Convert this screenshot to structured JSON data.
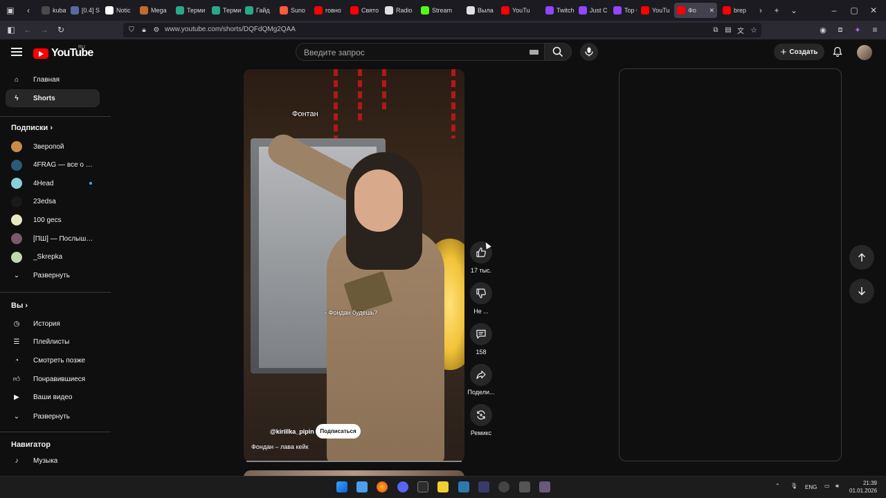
{
  "browser": {
    "tabs": [
      {
        "title": "kubat",
        "color": "#4a4a4a"
      },
      {
        "title": "[0.4] S",
        "color": "#5a6aa0"
      },
      {
        "title": "Notic",
        "color": "#ffffff"
      },
      {
        "title": "Mega",
        "color": "#c46a2a"
      },
      {
        "title": "Терми",
        "color": "#2aa88a"
      },
      {
        "title": "Терми",
        "color": "#2aa88a"
      },
      {
        "title": "Гайд",
        "color": "#2aa88a"
      },
      {
        "title": "Suno",
        "color": "#ff5a3a"
      },
      {
        "title": "говно",
        "color": "#ff0000"
      },
      {
        "title": "Свято",
        "color": "#ff0000"
      },
      {
        "title": "Radio",
        "color": "#e0e0e0"
      },
      {
        "title": "Stream",
        "color": "#53fc18"
      },
      {
        "title": "Выла",
        "color": "#e0e0e0"
      },
      {
        "title": "YouTu",
        "color": "#ff0000"
      },
      {
        "title": "Twitch",
        "color": "#9146ff"
      },
      {
        "title": "Just C",
        "color": "#9146ff"
      },
      {
        "title": "Top C",
        "color": "#9146ff"
      },
      {
        "title": "YouTu",
        "color": "#ff0000"
      },
      {
        "title": "Фо",
        "color": "#ff0000",
        "active": true
      },
      {
        "title": "brep",
        "color": "#ff0000"
      }
    ],
    "url": "www.youtube.com/shorts/DQFdQMg2QAA"
  },
  "header": {
    "logo_text": "YouTube",
    "logo_region": "RU",
    "search_placeholder": "Введите запрос",
    "create_label": "Создать"
  },
  "sidebar": {
    "top": [
      {
        "label": "Главная",
        "icon": "home-icon"
      },
      {
        "label": "Shorts",
        "icon": "shorts-icon",
        "active": true
      }
    ],
    "subscriptions_heading": "Подписки",
    "subscriptions": [
      {
        "label": "Зверопой",
        "color": "#c98a4a"
      },
      {
        "label": "4FRAG — все о сов...",
        "color": "#2a5a7a"
      },
      {
        "label": "4Head",
        "color": "#8ad0d8",
        "new": true
      },
      {
        "label": "23edsa",
        "color": "#1a1a1a"
      },
      {
        "label": "100 gecs",
        "color": "#e8e8c0"
      },
      {
        "label": "[ПШ] — Послышал...",
        "color": "#7a5a6a"
      },
      {
        "label": "_Skrepka",
        "color": "#c0d8b0"
      }
    ],
    "subs_expand": "Развернуть",
    "you_heading": "Вы",
    "you_items": [
      {
        "label": "История",
        "icon": "history-icon"
      },
      {
        "label": "Плейлисты",
        "icon": "playlists-icon"
      },
      {
        "label": "Смотреть позже",
        "icon": "watch-later-icon"
      },
      {
        "label": "Понравившиеся",
        "icon": "liked-icon"
      },
      {
        "label": "Ваши видео",
        "icon": "your-videos-icon"
      }
    ],
    "you_expand": "Развернуть",
    "navigator_heading": "Навигатор",
    "navigator_items": [
      {
        "label": "Музыка",
        "icon": "music-icon"
      }
    ]
  },
  "short": {
    "title_overlay": "Фонтан",
    "subtitle": "- Фондан будешь?",
    "channel": "@kirillka_pipin",
    "subscribe_label": "Подписаться",
    "caption": "Фондан – лава кейк"
  },
  "actions": {
    "like_count": "17 тыс.",
    "dislike_label": "Не ...",
    "comments_count": "158",
    "share_label": "Подели...",
    "remix_label": "Ремикс"
  },
  "taskbar": {
    "lang": "ENG",
    "time": "21:39",
    "date": "01.01.2026"
  }
}
